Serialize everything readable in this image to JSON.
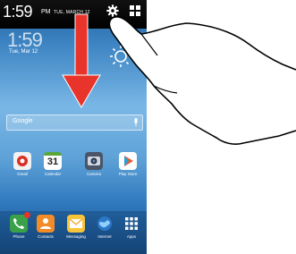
{
  "status_bar": {
    "time": "1:59",
    "ampm": "PM",
    "date": "TUE, MARCH 12",
    "settings_icon": "gear-icon",
    "quick_panel_icon": "grid-icon"
  },
  "home": {
    "clock": "1:59",
    "date": "Tue, Mar 12",
    "weather_icon": "sun-icon",
    "location_line1": "R",
    "location_line2": "ny",
    "location_line3": "n"
  },
  "search": {
    "placeholder": "Google",
    "mic_icon": "mic-icon"
  },
  "apps": [
    {
      "label": "Gmail",
      "icon": "gmail-icon"
    },
    {
      "label": "Calendar",
      "icon": "calendar-icon",
      "day": "31"
    },
    {
      "label": "Camera",
      "icon": "camera-icon"
    },
    {
      "label": "Play Store",
      "icon": "play-store-icon"
    }
  ],
  "dock": [
    {
      "label": "Phone",
      "icon": "phone-icon"
    },
    {
      "label": "Contacts",
      "icon": "contacts-icon"
    },
    {
      "label": "Messaging",
      "icon": "messaging-icon"
    },
    {
      "label": "Internet",
      "icon": "internet-icon"
    },
    {
      "label": "Apps",
      "icon": "apps-icon"
    }
  ],
  "colors": {
    "arrow": "#e8342b",
    "status_bar": "#000000",
    "hand_outline": "#000000"
  }
}
